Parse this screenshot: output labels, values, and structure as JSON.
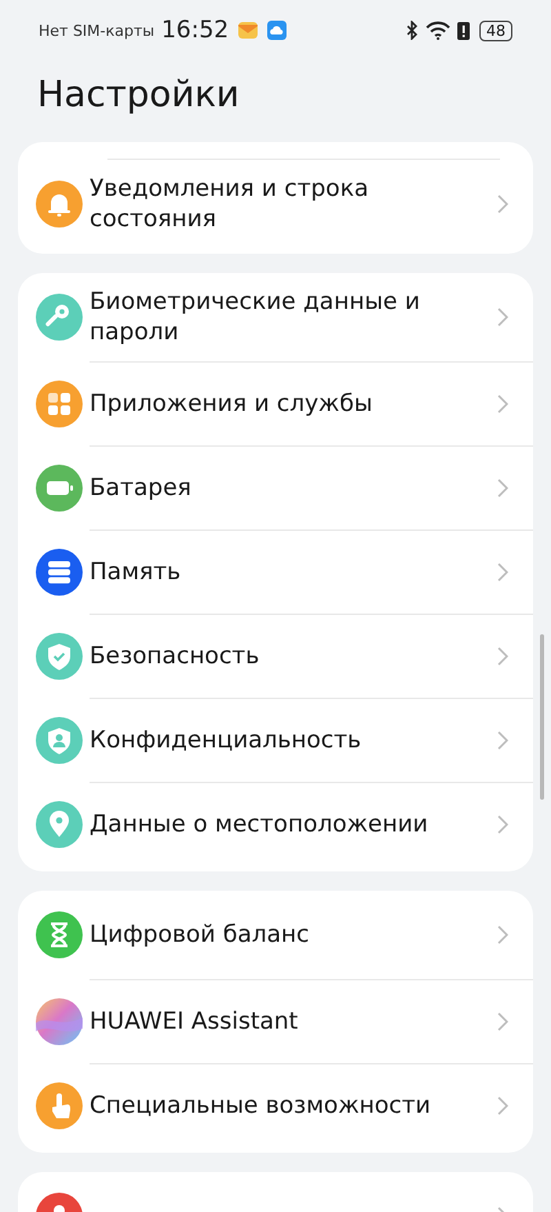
{
  "status_bar": {
    "carrier": "Нет SIM-карты",
    "time": "16:52",
    "battery": "48"
  },
  "title": "Настройки",
  "groups": [
    {
      "top_divider": true,
      "items": [
        {
          "label": "Уведомления и строка состояния",
          "kind": "bell"
        }
      ]
    },
    {
      "top_divider": false,
      "items": [
        {
          "label": "Биометрические данные и пароли",
          "kind": "key"
        },
        {
          "label": "Приложения и службы",
          "kind": "apps"
        },
        {
          "label": "Батарея",
          "kind": "battery"
        },
        {
          "label": "Память",
          "kind": "storage"
        },
        {
          "label": "Безопасность",
          "kind": "shield"
        },
        {
          "label": "Конфиденциальность",
          "kind": "privacy"
        },
        {
          "label": "Данные о местоположении",
          "kind": "location"
        }
      ]
    },
    {
      "top_divider": false,
      "items": [
        {
          "label": "Цифровой баланс",
          "kind": "hourglass"
        },
        {
          "label": "HUAWEI Assistant",
          "kind": "assistant"
        },
        {
          "label": "Специальные возможности",
          "kind": "accessibility"
        }
      ]
    },
    {
      "top_divider": false,
      "items": [
        {
          "kind": "user"
        }
      ]
    }
  ]
}
